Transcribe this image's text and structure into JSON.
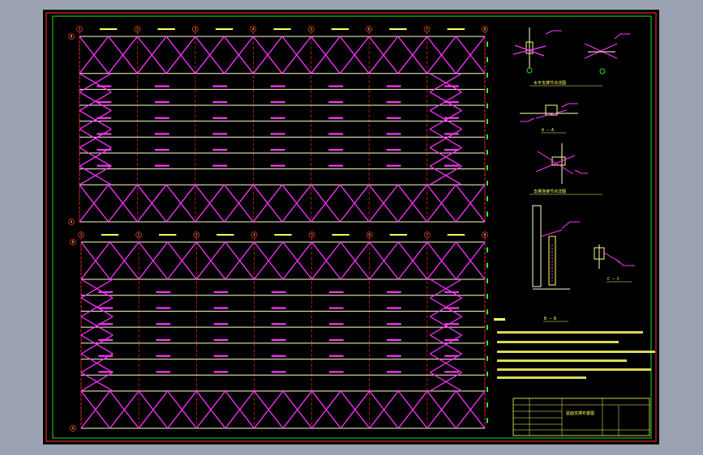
{
  "drawing": {
    "colors": {
      "background": "#000000",
      "viewport": "#9aa1b0",
      "border_outer": "#ff3333",
      "border_inner": "#22dd22",
      "brace": "#ff33ff",
      "member": "#ffffcc",
      "axis": "#ff3333",
      "text": "#ffff66",
      "dims": "#33ff33"
    },
    "axes_top": [
      "1",
      "2",
      "3",
      "4",
      "5",
      "6",
      "7",
      "8"
    ],
    "axes_bottom": [
      "1",
      "2",
      "3",
      "4",
      "5",
      "6",
      "7",
      "8"
    ],
    "row_top": [
      "B",
      "A"
    ],
    "row_bottom": [
      "B",
      "A"
    ],
    "sections": {
      "aa": "A — A",
      "bb": "B — B",
      "cc": "C — C"
    },
    "title_block": {
      "project": "屋面支撑布置图"
    }
  }
}
